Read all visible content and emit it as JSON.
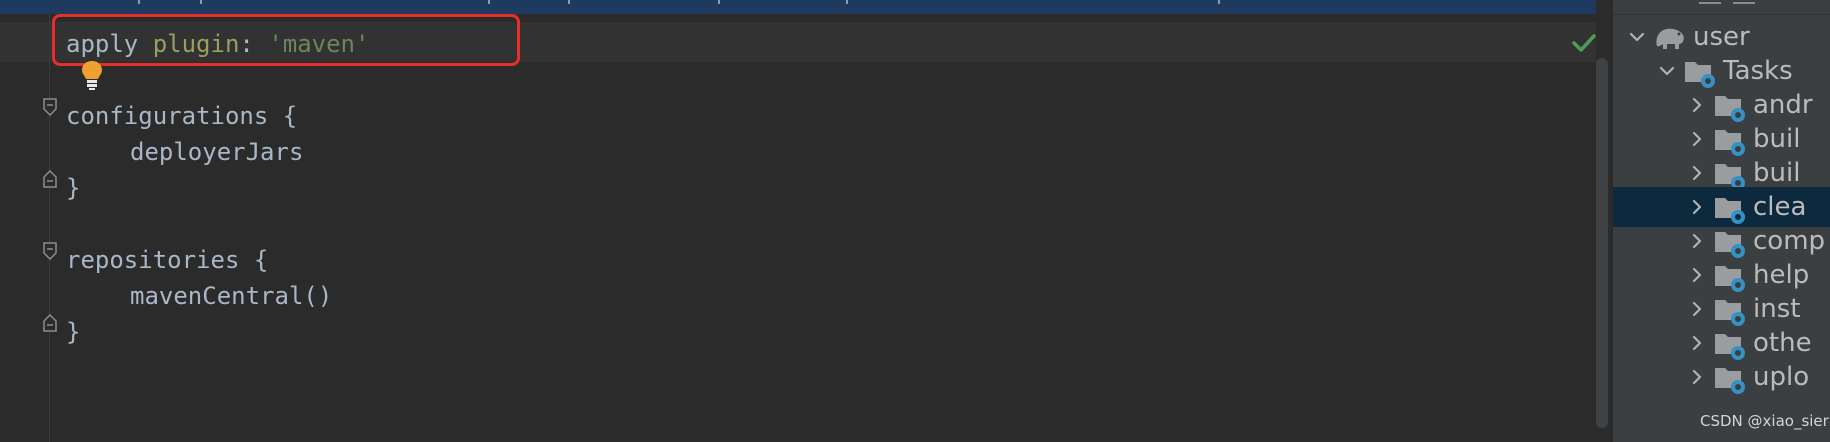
{
  "editor": {
    "lines": {
      "apply_kw": "apply",
      "apply_plugin": "plugin",
      "apply_colon": ":",
      "apply_value": "'maven'",
      "configurations": "configurations {",
      "deployer_jars": "deployerJars",
      "close1": "}",
      "repositories": "repositories {",
      "maven_central": "mavenCentral()",
      "close2": "}"
    },
    "status": "no-problems",
    "highlight_color": "#e5302a"
  },
  "gradle_panel": {
    "root": "user",
    "tasks_folder": "Tasks",
    "task_groups": [
      "andr",
      "buil",
      "buil",
      "clea",
      "comp",
      "help",
      "inst",
      "othe",
      "uplo"
    ],
    "selected_index": 3,
    "icons": {
      "root": "gradle-elephant-icon",
      "folder": "folder-gear-icon"
    }
  },
  "watermark": "CSDN @xiao_sier",
  "colors": {
    "editor_bg": "#2b2b2b",
    "panel_bg": "#3c3f41",
    "selected_row": "#0d293e",
    "string": "#6a8759",
    "accent_blue": "#3592c4"
  }
}
